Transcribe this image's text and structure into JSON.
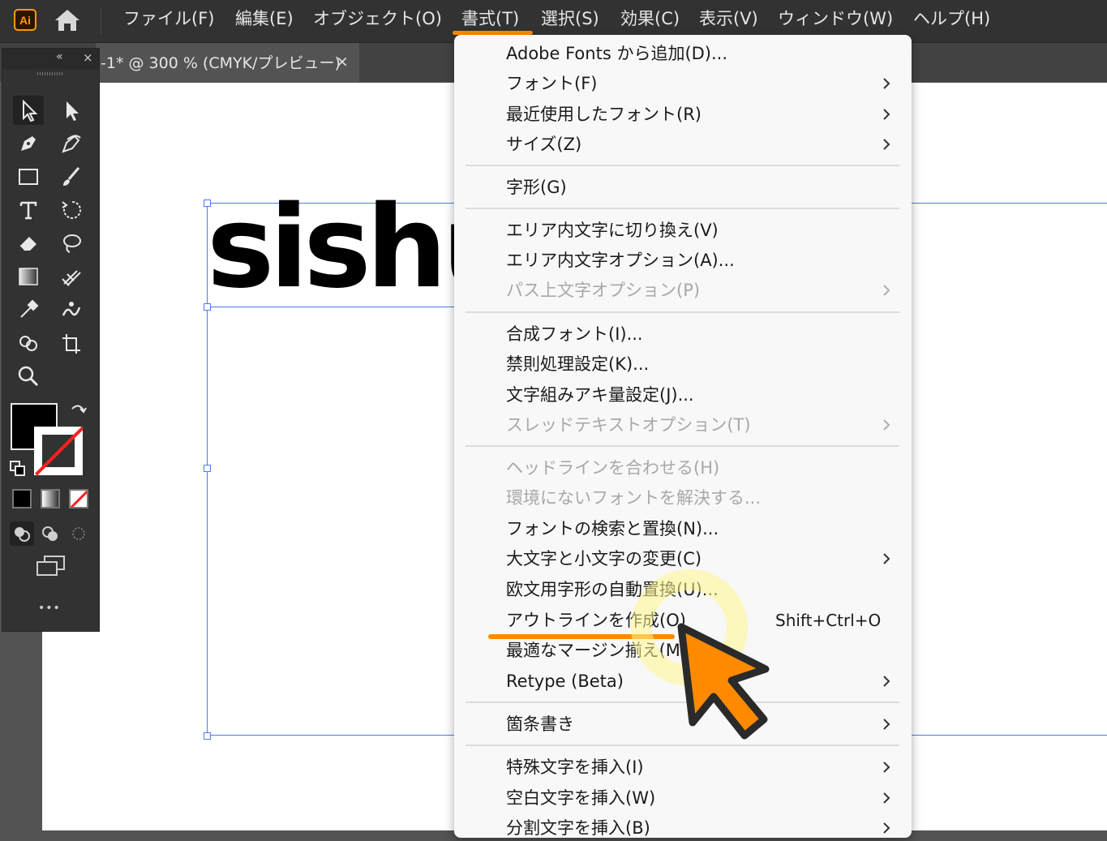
{
  "app": {
    "logo_text": "Ai",
    "accent": "#ff9a00"
  },
  "menubar": {
    "items": [
      "ファイル(F)",
      "編集(E)",
      "オブジェクト(O)",
      "書式(T)",
      "選択(S)",
      "効果(C)",
      "表示(V)",
      "ウィンドウ(W)",
      "ヘルプ(H)"
    ],
    "active_item": "書式(T)",
    "highlight_color": "#ff8a00"
  },
  "document_tab": {
    "title": "-1* @ 300 % (CMYK/プレビュー)",
    "close_glyph": "×"
  },
  "toolbar": {
    "collapse_glyph": "«",
    "close_glyph": "×",
    "more_glyph": "•••",
    "tools": [
      "selection-tool",
      "direct-selection-tool",
      "pen-tool",
      "curvature-tool",
      "rectangle-tool",
      "paintbrush-tool",
      "type-tool",
      "rotate-tool",
      "eraser-tool",
      "lasso-tool",
      "gradient-tool",
      "mesh-tool",
      "eyedropper-tool",
      "puppet-warp-tool",
      "shape-builder-tool",
      "artboard-tool",
      "zoom-tool"
    ],
    "fill_color": "#000000",
    "stroke": "none"
  },
  "canvas": {
    "sample_text": "sishu"
  },
  "dropdown": {
    "items": [
      {
        "label": "Adobe Fonts から追加(D)...",
        "submenu": false,
        "disabled": false
      },
      {
        "label": "フォント(F)",
        "submenu": true,
        "disabled": false
      },
      {
        "label": "最近使用したフォント(R)",
        "submenu": true,
        "disabled": false
      },
      {
        "label": "サイズ(Z)",
        "submenu": true,
        "disabled": false
      },
      {
        "label": "字形(G)",
        "submenu": false,
        "disabled": false
      },
      {
        "label": "エリア内文字に切り換え(V)",
        "submenu": false,
        "disabled": false
      },
      {
        "label": "エリア内文字オプション(A)...",
        "submenu": false,
        "disabled": false
      },
      {
        "label": "パス上文字オプション(P)",
        "submenu": true,
        "disabled": true
      },
      {
        "label": "合成フォント(I)...",
        "submenu": false,
        "disabled": false
      },
      {
        "label": "禁則処理設定(K)...",
        "submenu": false,
        "disabled": false
      },
      {
        "label": "文字組みアキ量設定(J)...",
        "submenu": false,
        "disabled": false
      },
      {
        "label": "スレッドテキストオプション(T)",
        "submenu": true,
        "disabled": true
      },
      {
        "label": "ヘッドラインを合わせる(H)",
        "submenu": false,
        "disabled": true
      },
      {
        "label": "環境にないフォントを解決する...",
        "submenu": false,
        "disabled": true
      },
      {
        "label": "フォントの検索と置換(N)...",
        "submenu": false,
        "disabled": false
      },
      {
        "label": "大文字と小文字の変更(C)",
        "submenu": true,
        "disabled": false
      },
      {
        "label": "欧文用字形の自動置換(U)...",
        "submenu": false,
        "disabled": false
      },
      {
        "label": "アウトラインを作成(O)",
        "submenu": false,
        "disabled": false,
        "shortcut": "Shift+Ctrl+O",
        "highlighted": true
      },
      {
        "label": "最適なマージン揃え(M)",
        "submenu": false,
        "disabled": false
      },
      {
        "label": "Retype (Beta)",
        "submenu": true,
        "disabled": false
      },
      {
        "label": "箇条書き",
        "submenu": true,
        "disabled": false
      },
      {
        "label": "特殊文字を挿入(I)",
        "submenu": true,
        "disabled": false
      },
      {
        "label": "空白文字を挿入(W)",
        "submenu": true,
        "disabled": false
      },
      {
        "label": "分割文字を挿入(B)",
        "submenu": true,
        "disabled": false
      }
    ]
  },
  "annotation": {
    "cursor_color": "#ff8a00",
    "highlight_color": "#fff68c"
  }
}
